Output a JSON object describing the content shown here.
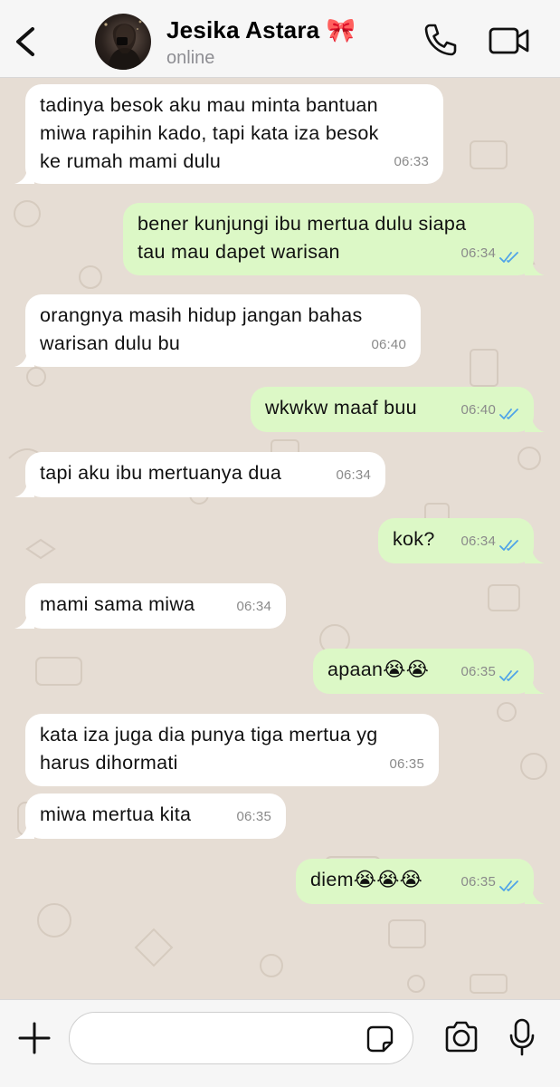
{
  "header": {
    "contact_name": "Jesika Astara 🎀",
    "status": "online"
  },
  "messages": [
    {
      "side": "in",
      "lines": [
        "tadinya besok aku mau minta bantuan",
        "miwa rapihin kado, tapi kata iza besok",
        "ke rumah mami dulu"
      ],
      "time": "06:33"
    },
    {
      "side": "out",
      "lines": [
        "bener kunjungi ibu mertua dulu siapa",
        "tau mau dapet warisan"
      ],
      "time": "06:34",
      "read": true
    },
    {
      "side": "in",
      "lines": [
        "orangnya masih hidup jangan bahas",
        "warisan dulu bu"
      ],
      "time": "06:40"
    },
    {
      "side": "out",
      "lines": [
        "wkwkw maaf buu"
      ],
      "time": "06:40",
      "read": true
    },
    {
      "side": "in",
      "lines": [
        "tapi aku ibu mertuanya dua"
      ],
      "time": "06:34"
    },
    {
      "side": "out",
      "lines": [
        "kok?"
      ],
      "time": "06:34",
      "read": true
    },
    {
      "side": "in",
      "lines": [
        "mami sama miwa"
      ],
      "time": "06:34"
    },
    {
      "side": "out",
      "lines": [
        "apaan😭😭"
      ],
      "time": "06:35",
      "read": true
    },
    {
      "side": "in",
      "lines": [
        "kata iza juga dia punya tiga mertua yg",
        "harus dihormati"
      ],
      "time": "06:35"
    },
    {
      "side": "in",
      "lines": [
        "miwa mertua kita"
      ],
      "time": "06:35"
    },
    {
      "side": "out",
      "lines": [
        "diem😭😭😭"
      ],
      "time": "06:35",
      "read": true
    }
  ],
  "composer": {
    "text": ""
  },
  "colors": {
    "header_bg": "#f6f6f6",
    "chat_bg": "#e6ddd4",
    "incoming_bubble": "#ffffff",
    "outgoing_bubble": "#dcf8c6",
    "read_ticks": "#4fa3e8"
  },
  "icons": {
    "back": "chevron-left-icon",
    "call": "phone-icon",
    "video": "video-camera-icon",
    "attach": "plus-icon",
    "sticker": "sticker-icon",
    "camera": "camera-icon",
    "mic": "microphone-icon"
  }
}
